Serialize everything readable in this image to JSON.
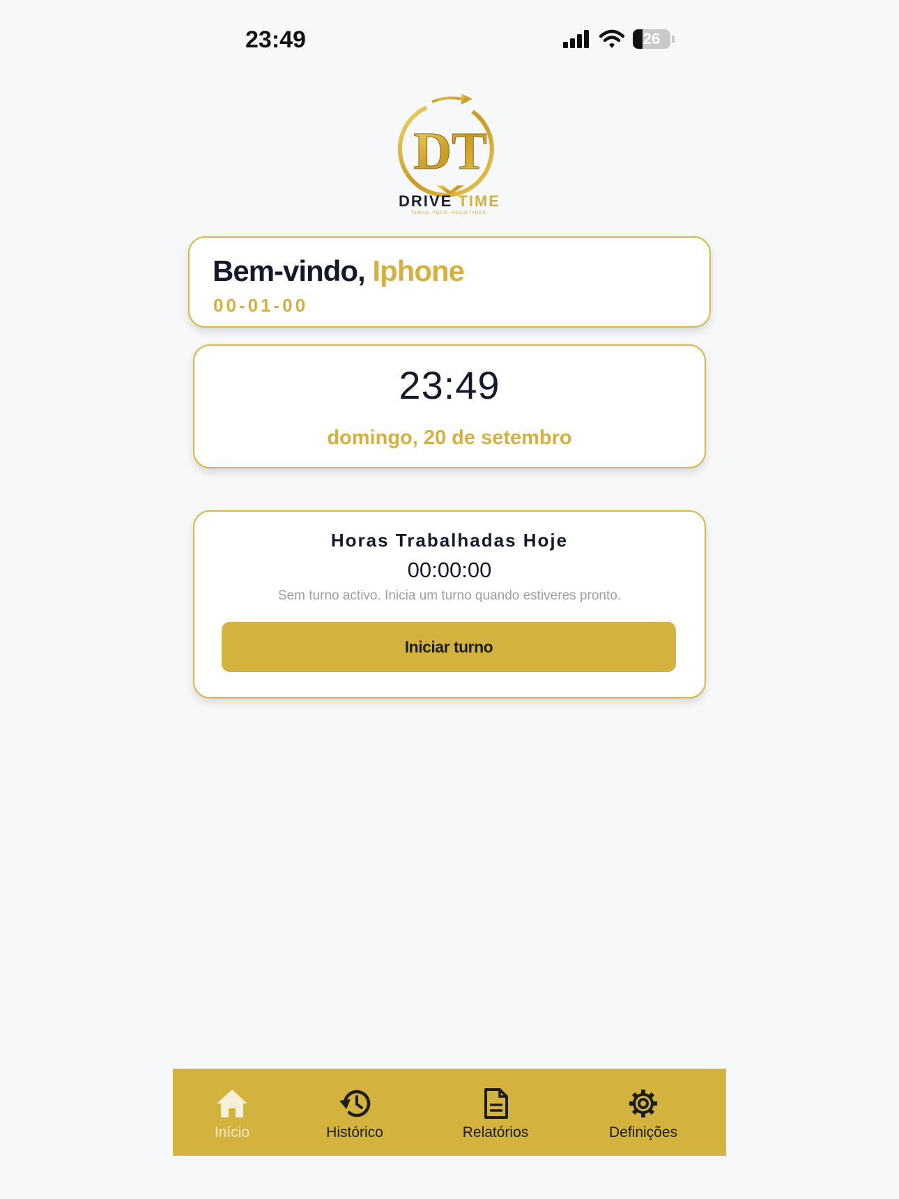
{
  "status_bar": {
    "time": "23:49",
    "battery": "26"
  },
  "brand": {
    "monogram": "DT",
    "name_part1": "DRIVE",
    "name_part2": "TIME",
    "tagline": "TEMPO. FOCO. RESULTADOS."
  },
  "welcome": {
    "greeting": "Bem-vindo,",
    "user_name": "Iphone",
    "code": "00-01-00"
  },
  "clock": {
    "time": "23:49",
    "date": "domingo, 20 de setembro"
  },
  "hours_card": {
    "title": "Horas Trabalhadas Hoje",
    "value": "00:00:00",
    "message": "Sem turno activo. Inicia um turno quando estiveres pronto.",
    "button_label": "Iniciar turno"
  },
  "nav": {
    "items": [
      {
        "label": "Início",
        "icon": "home-icon",
        "active": true
      },
      {
        "label": "Histórico",
        "icon": "history-icon",
        "active": false
      },
      {
        "label": "Relatórios",
        "icon": "document-icon",
        "active": false
      },
      {
        "label": "Definições",
        "icon": "gear-icon",
        "active": false
      }
    ]
  },
  "colors": {
    "accent": "#d4b23e",
    "text_dark": "#141a2b",
    "background": "#f7f8fa"
  }
}
